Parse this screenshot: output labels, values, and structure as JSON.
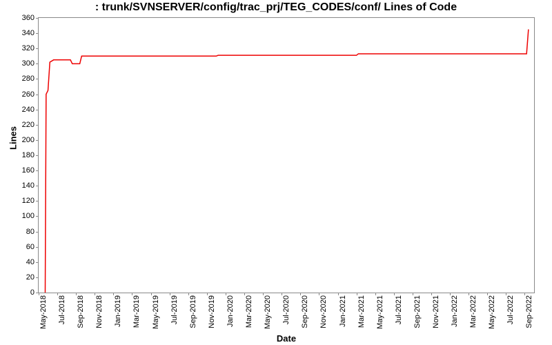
{
  "chart_data": {
    "type": "line",
    "title": ": trunk/SVNSERVER/config/trac_prj/TEG_CODES/conf/ Lines of Code",
    "xlabel": "Date",
    "ylabel": "Lines",
    "ylim": [
      0,
      360
    ],
    "yticks": [
      0,
      20,
      40,
      60,
      80,
      100,
      120,
      140,
      160,
      180,
      200,
      220,
      240,
      260,
      280,
      300,
      320,
      340,
      360
    ],
    "xticks": [
      "May-2018",
      "Jul-2018",
      "Sep-2018",
      "Nov-2018",
      "Jan-2019",
      "Mar-2019",
      "May-2019",
      "Jul-2019",
      "Sep-2019",
      "Nov-2019",
      "Jan-2020",
      "Mar-2020",
      "May-2020",
      "Jul-2020",
      "Sep-2020",
      "Nov-2020",
      "Jan-2021",
      "Mar-2021",
      "May-2021",
      "Jul-2021",
      "Sep-2021",
      "Nov-2021",
      "Jan-2022",
      "Mar-2022",
      "May-2022",
      "Jul-2022",
      "Sep-2022"
    ],
    "xrange": [
      0,
      53
    ],
    "series": [
      {
        "name": "lines-of-code",
        "color": "#ee0000",
        "points": [
          {
            "x": 0.7,
            "y": 0
          },
          {
            "x": 0.8,
            "y": 260
          },
          {
            "x": 1.0,
            "y": 265
          },
          {
            "x": 1.2,
            "y": 302
          },
          {
            "x": 1.6,
            "y": 305
          },
          {
            "x": 3.4,
            "y": 305
          },
          {
            "x": 3.6,
            "y": 300
          },
          {
            "x": 4.4,
            "y": 300
          },
          {
            "x": 4.6,
            "y": 310
          },
          {
            "x": 19.0,
            "y": 310
          },
          {
            "x": 19.2,
            "y": 311
          },
          {
            "x": 34.0,
            "y": 311
          },
          {
            "x": 34.2,
            "y": 313
          },
          {
            "x": 52.2,
            "y": 313
          },
          {
            "x": 52.4,
            "y": 345
          }
        ]
      }
    ]
  }
}
